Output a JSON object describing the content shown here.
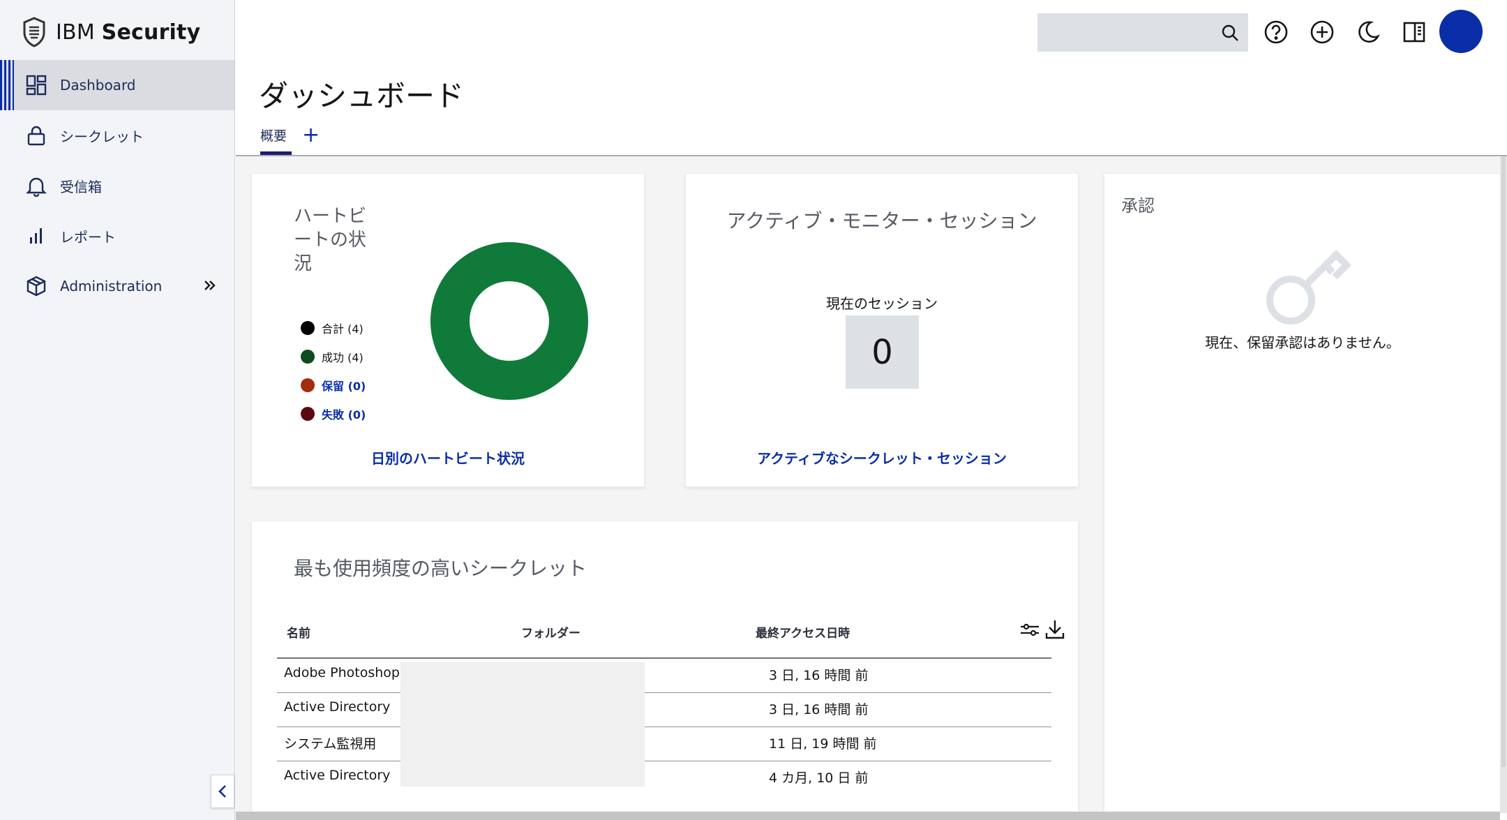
{
  "brand": {
    "prefix": "IBM",
    "name": "Security"
  },
  "sidebar": {
    "items": [
      {
        "label": "Dashboard",
        "icon": "dashboard-icon",
        "active": true
      },
      {
        "label": "シークレット",
        "icon": "lock-icon"
      },
      {
        "label": "受信箱",
        "icon": "bell-icon"
      },
      {
        "label": "レポート",
        "icon": "bar-chart-icon"
      },
      {
        "label": "Administration",
        "icon": "cube-icon"
      }
    ],
    "collapse_icon": "chevron-left-icon"
  },
  "header": {
    "search": {
      "placeholder": "",
      "icon": "search-icon"
    },
    "icons": [
      "help-icon",
      "add-icon",
      "moon-icon",
      "panel-icon"
    ],
    "avatar_color": "#0a2ea8"
  },
  "page": {
    "title": "ダッシュボード",
    "tabs": [
      {
        "label": "概要",
        "active": true
      }
    ],
    "add_tab": "+"
  },
  "heartbeat": {
    "title": "ハートビートの状況",
    "title_lines": [
      "ハートビ",
      "ートの状",
      "況"
    ],
    "legend": [
      {
        "label": "合計 (4)",
        "color": "#000000"
      },
      {
        "label": "成功 (4)",
        "color": "#0e4a1f"
      },
      {
        "label": "保留 (0)",
        "color": "#a42c0f"
      },
      {
        "label": "失敗 (0)",
        "color": "#5c0a12"
      }
    ],
    "donut": {
      "success": 4,
      "pending": 0,
      "failed": 0,
      "color": "#0f7a3a"
    },
    "link": "日別のハートビート状況"
  },
  "active_monitor": {
    "title": "アクティブ・モニター・セッション",
    "label": "現在のセッション",
    "count": "0",
    "link": "アクティブなシークレット・セッション"
  },
  "approvals": {
    "title": "承認",
    "empty": "現在、保留承認はありません。"
  },
  "top_secrets": {
    "title": "最も使用頻度の高いシークレット",
    "columns": [
      "名前",
      "フォルダー",
      "最終アクセス日時"
    ],
    "rows": [
      {
        "name": "Adobe Photoshop",
        "last": "3 日, 16 時間 前"
      },
      {
        "name": "Active Directory",
        "last": "3 日, 16 時間 前"
      },
      {
        "name": "システム監視用",
        "last": "11 日, 19 時間 前"
      },
      {
        "name": "Active Directory",
        "last": "4 カ月, 10 日 前"
      }
    ],
    "icons": [
      "filter-icon",
      "download-icon"
    ]
  }
}
